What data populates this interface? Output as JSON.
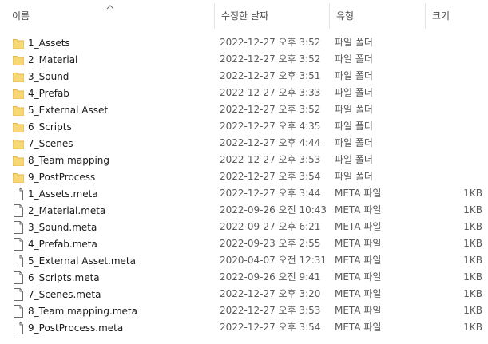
{
  "columns": {
    "name": "이름",
    "date": "수정한 날짜",
    "type": "유형",
    "size": "크기"
  },
  "sort": {
    "icon": "chevron-up-icon",
    "column": "name",
    "direction": "ascending"
  },
  "colors": {
    "folder": "#f8d775",
    "folder_tab": "#e6b84a",
    "file_outline": "#6b6b6b",
    "header_text": "#4d4d4d",
    "separator": "#e5e5e5"
  },
  "rows": [
    {
      "icon": "folder-icon",
      "name": "1_Assets",
      "date": "2022-12-27 오후 3:52",
      "type": "파일 폴더",
      "size": ""
    },
    {
      "icon": "folder-icon",
      "name": "2_Material",
      "date": "2022-12-27 오후 3:52",
      "type": "파일 폴더",
      "size": ""
    },
    {
      "icon": "folder-icon",
      "name": "3_Sound",
      "date": "2022-12-27 오후 3:51",
      "type": "파일 폴더",
      "size": ""
    },
    {
      "icon": "folder-icon",
      "name": "4_Prefab",
      "date": "2022-12-27 오후 3:33",
      "type": "파일 폴더",
      "size": ""
    },
    {
      "icon": "folder-icon",
      "name": "5_External Asset",
      "date": "2022-12-27 오후 3:52",
      "type": "파일 폴더",
      "size": ""
    },
    {
      "icon": "folder-icon",
      "name": "6_Scripts",
      "date": "2022-12-27 오후 4:35",
      "type": "파일 폴더",
      "size": ""
    },
    {
      "icon": "folder-icon",
      "name": "7_Scenes",
      "date": "2022-12-27 오후 4:44",
      "type": "파일 폴더",
      "size": ""
    },
    {
      "icon": "folder-icon",
      "name": "8_Team mapping",
      "date": "2022-12-27 오후 3:53",
      "type": "파일 폴더",
      "size": ""
    },
    {
      "icon": "folder-icon",
      "name": "9_PostProcess",
      "date": "2022-12-27 오후 3:54",
      "type": "파일 폴더",
      "size": ""
    },
    {
      "icon": "file-icon",
      "name": "1_Assets.meta",
      "date": "2022-12-27 오후 3:44",
      "type": "META 파일",
      "size": "1KB"
    },
    {
      "icon": "file-icon",
      "name": "2_Material.meta",
      "date": "2022-09-26 오전 10:43",
      "type": "META 파일",
      "size": "1KB"
    },
    {
      "icon": "file-icon",
      "name": "3_Sound.meta",
      "date": "2022-09-27 오후 6:21",
      "type": "META 파일",
      "size": "1KB"
    },
    {
      "icon": "file-icon",
      "name": "4_Prefab.meta",
      "date": "2022-09-23 오후 2:55",
      "type": "META 파일",
      "size": "1KB"
    },
    {
      "icon": "file-icon",
      "name": "5_External Asset.meta",
      "date": "2020-04-07 오전 12:31",
      "type": "META 파일",
      "size": "1KB"
    },
    {
      "icon": "file-icon",
      "name": "6_Scripts.meta",
      "date": "2022-09-26 오전 9:41",
      "type": "META 파일",
      "size": "1KB"
    },
    {
      "icon": "file-icon",
      "name": "7_Scenes.meta",
      "date": "2022-12-27 오후 3:20",
      "type": "META 파일",
      "size": "1KB"
    },
    {
      "icon": "file-icon",
      "name": "8_Team mapping.meta",
      "date": "2022-12-27 오후 3:53",
      "type": "META 파일",
      "size": "1KB"
    },
    {
      "icon": "file-icon",
      "name": "9_PostProcess.meta",
      "date": "2022-12-27 오후 3:54",
      "type": "META 파일",
      "size": "1KB"
    }
  ]
}
